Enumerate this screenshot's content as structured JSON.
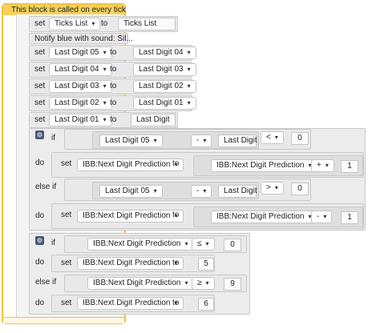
{
  "event": {
    "label": "This block is called on every tick"
  },
  "kw": {
    "set": "set",
    "to": "to",
    "if": "if",
    "else_if": "else if",
    "do": "do"
  },
  "rows": {
    "r1": {
      "var": "Ticks List",
      "value": "Ticks List"
    },
    "notify": "Notify blue with sound: Sil...",
    "r3": {
      "var": "Last Digit 05",
      "value": "Last Digit 04"
    },
    "r4": {
      "var": "Last Digit 04",
      "value": "Last Digit 03"
    },
    "r5": {
      "var": "Last Digit 03",
      "value": "Last Digit 02"
    },
    "r6": {
      "var": "Last Digit 02",
      "value": "Last Digit 01"
    },
    "r7": {
      "var": "Last Digit 01",
      "value": "Last Digit"
    }
  },
  "if1": {
    "cond1": {
      "a": "Last Digit 05",
      "op": "-",
      "b": "Last Digit",
      "cmp": "<",
      "n": "0"
    },
    "do1": {
      "var": "IBB:Next Digit Prediction",
      "a": "IBB:Next Digit Prediction",
      "op": "+",
      "n": "1"
    },
    "cond2": {
      "a": "Last Digit 05",
      "op": "-",
      "b": "Last Digit",
      "cmp": ">",
      "n": "0"
    },
    "do2": {
      "var": "IBB:Next Digit Prediction",
      "a": "IBB:Next Digit Prediction",
      "op": "-",
      "n": "1"
    }
  },
  "if2": {
    "cond1": {
      "a": "IBB:Next Digit Prediction",
      "cmp": "≤",
      "n": "0"
    },
    "do1": {
      "var": "IBB:Next Digit Prediction",
      "n": "5"
    },
    "cond2": {
      "a": "IBB:Next Digit Prediction",
      "cmp": "≥",
      "n": "9"
    },
    "do2": {
      "var": "IBB:Next Digit Prediction",
      "n": "6"
    }
  },
  "icons": {
    "gear": "gear-icon",
    "dropdown": "dropdown-arrow-icon"
  },
  "colors": {
    "event_accent": "#f3c33a",
    "block": "#e9e9e9",
    "gear": "#4a5a78"
  }
}
